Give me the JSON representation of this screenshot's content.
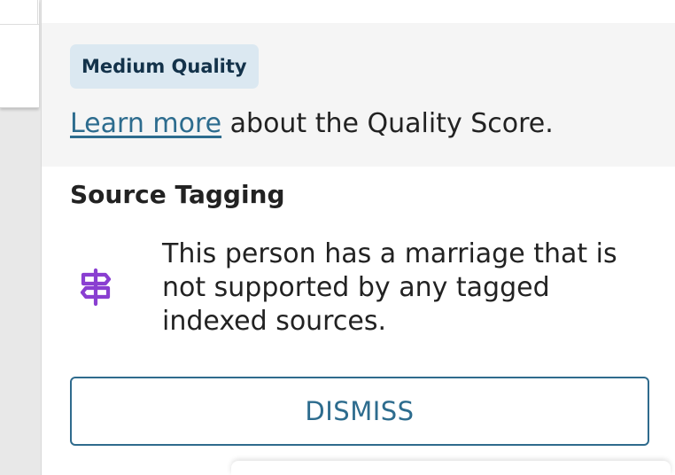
{
  "quality": {
    "badge_label": "Medium Quality",
    "learn_more_link": "Learn more",
    "learn_more_suffix": "about the Quality Score."
  },
  "source_tagging": {
    "title": "Source Tagging",
    "icon": "signpost-icon",
    "message": "This person has a marriage that is not supported by any tagged indexed sources.",
    "dismiss_label": "DISMISS"
  },
  "colors": {
    "badge_bg": "#dbe8f1",
    "badge_text": "#13324a",
    "link": "#2d6c8e",
    "icon": "#8a3fd1",
    "button_border": "#2f6b8d"
  }
}
